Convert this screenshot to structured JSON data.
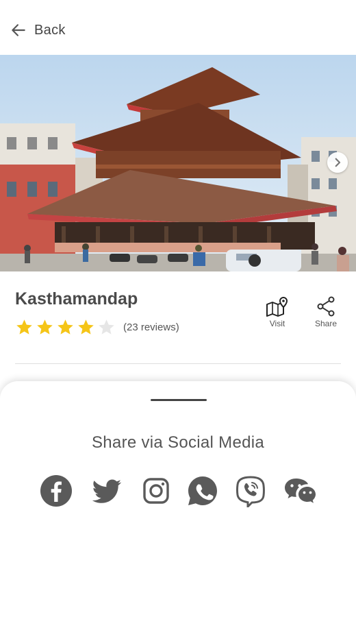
{
  "header": {
    "back_label": "Back",
    "back_icon": "arrow-left-icon"
  },
  "hero": {
    "image_subject": "Kasthamandap",
    "next_icon": "chevron-right-icon"
  },
  "place": {
    "name": "Kasthamandap",
    "rating": 4,
    "rating_max": 5,
    "reviews_label": "(23 reviews)",
    "star_color": "#f5c518",
    "star_empty_color": "#e6e6e6"
  },
  "actions": {
    "visit_label": "Visit",
    "visit_icon": "map-pin-icon",
    "share_label": "Share",
    "share_icon": "share-icon"
  },
  "share_sheet": {
    "title": "Share via Social Media",
    "icon_color": "#5a5a5a",
    "networks": [
      {
        "name": "facebook",
        "icon": "facebook-icon"
      },
      {
        "name": "twitter",
        "icon": "twitter-icon"
      },
      {
        "name": "instagram",
        "icon": "instagram-icon"
      },
      {
        "name": "whatsapp",
        "icon": "whatsapp-icon"
      },
      {
        "name": "viber",
        "icon": "viber-icon"
      },
      {
        "name": "wechat",
        "icon": "wechat-icon"
      }
    ]
  }
}
